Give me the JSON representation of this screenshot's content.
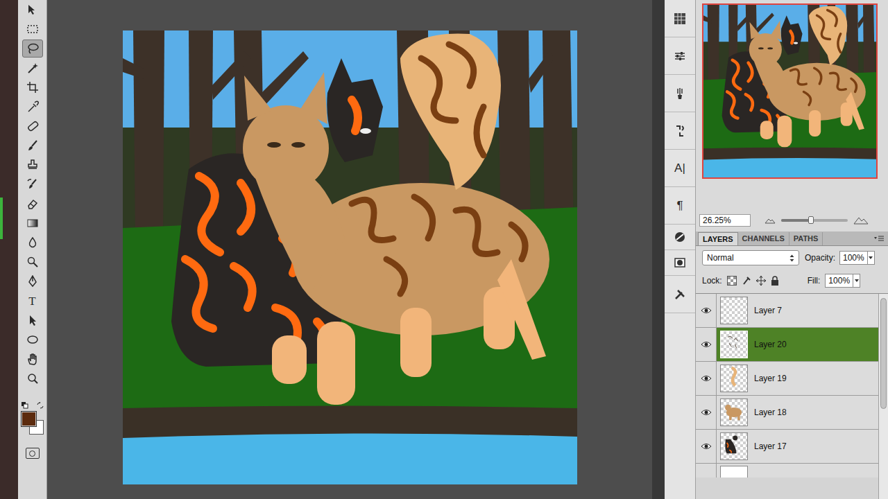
{
  "tools": [
    {
      "selected": false
    },
    {
      "selected": false
    },
    {
      "selected": true
    },
    {
      "selected": false
    },
    {
      "selected": false
    },
    {
      "selected": false
    },
    {
      "selected": false
    },
    {
      "selected": false
    },
    {
      "selected": false
    },
    {
      "selected": false
    },
    {
      "selected": false
    },
    {
      "selected": false
    },
    {
      "selected": false
    },
    {
      "selected": false
    },
    {
      "selected": false
    },
    {
      "selected": false,
      "glyph": "T"
    },
    {
      "selected": false
    },
    {
      "selected": false
    },
    {
      "selected": false
    },
    {
      "selected": false
    }
  ],
  "colors": {
    "foreground": "#5c2b0e",
    "background": "#ffffff"
  },
  "dock": [
    {
      "glyph": ""
    },
    {
      "glyph": ""
    },
    {
      "glyph": ""
    },
    {
      "glyph": ""
    },
    {
      "glyph": "A|"
    },
    {
      "glyph": "¶"
    },
    {
      "glyph": ""
    },
    {
      "glyph": ""
    },
    {
      "glyph": ""
    }
  ],
  "navigator": {
    "zoom": "26.25%",
    "level": 0.45
  },
  "layers_panel": {
    "tabs": [
      {
        "label": "LAYERS",
        "selected": true
      },
      {
        "label": "CHANNELS",
        "selected": false
      },
      {
        "label": "PATHS",
        "selected": false
      }
    ],
    "blend_mode": "Normal",
    "opacity_label": "Opacity:",
    "opacity": "100%",
    "lock_label": "Lock:",
    "fill_label": "Fill:",
    "fill": "100%",
    "layers": [
      {
        "name": "Layer 7",
        "visible": true,
        "selected": false
      },
      {
        "name": "Layer 20",
        "visible": true,
        "selected": true
      },
      {
        "name": "Layer 19",
        "visible": true,
        "selected": false
      },
      {
        "name": "Layer 18",
        "visible": true,
        "selected": false
      },
      {
        "name": "Layer 17",
        "visible": true,
        "selected": false
      }
    ]
  }
}
